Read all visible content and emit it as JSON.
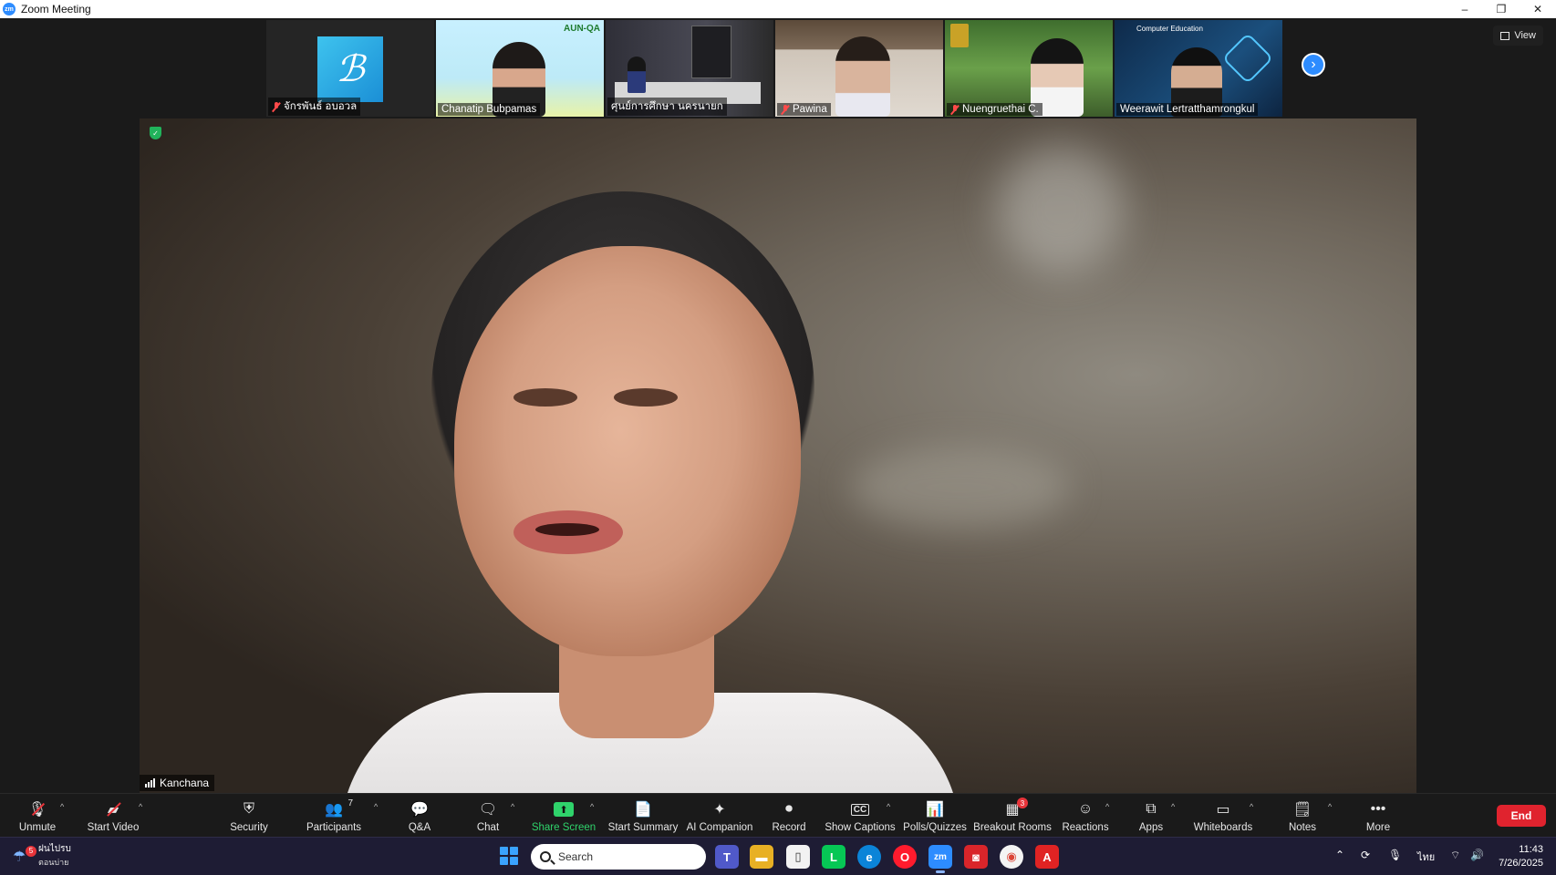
{
  "window": {
    "title": "Zoom Meeting",
    "app_icon_text": "zm",
    "controls": {
      "minimize": "–",
      "restore": "❐",
      "close": "✕"
    }
  },
  "view_button": {
    "label": "View"
  },
  "filmstrip": {
    "participants": [
      {
        "name": "จักรพันธ์ อบอวล",
        "muted": true,
        "logo_text": "ℬ"
      },
      {
        "name": "Chanatip Bubpamas",
        "muted": false,
        "brand_text": "AUN-QA"
      },
      {
        "name": "ศุนย์การศึกษา นครนายก",
        "muted": false
      },
      {
        "name": "Pawina",
        "muted": true
      },
      {
        "name": "Nuengruethai C.",
        "muted": true
      },
      {
        "name": "Weerawit Lertratthamrongkul",
        "muted": false,
        "caption": "Computer Education"
      }
    ],
    "next_arrow": "›"
  },
  "speaker": {
    "name": "Kanchana",
    "shield_glyph": "✓"
  },
  "toolbar": {
    "unmute": "Unmute",
    "start_video": "Start Video",
    "security": "Security",
    "participants": "Participants",
    "participants_count": "7",
    "qa": "Q&A",
    "chat": "Chat",
    "share_screen": "Share Screen",
    "start_summary": "Start Summary",
    "ai_companion": "AI Companion",
    "record": "Record",
    "show_captions": "Show Captions",
    "captions_icon": "CC",
    "polls": "Polls/Quizzes",
    "breakout": "Breakout Rooms",
    "breakout_badge": "3",
    "reactions": "Reactions",
    "apps": "Apps",
    "whiteboards": "Whiteboards",
    "notes": "Notes",
    "more": "More",
    "end": "End",
    "caret": "^"
  },
  "taskbar": {
    "weather_badge": "5",
    "weather_line1": "ฝนไปรบ",
    "weather_line2": "ตอนบ่าย",
    "search_placeholder": "Search",
    "lang": "ไทย",
    "time": "11:43",
    "date": "7/26/2025",
    "zoom_icon_text": "zm"
  },
  "colors": {
    "accent_blue": "#2d8cff",
    "end_red": "#e0232e",
    "share_green": "#2fd36b",
    "taskbar_bg": "#1e1c34"
  }
}
